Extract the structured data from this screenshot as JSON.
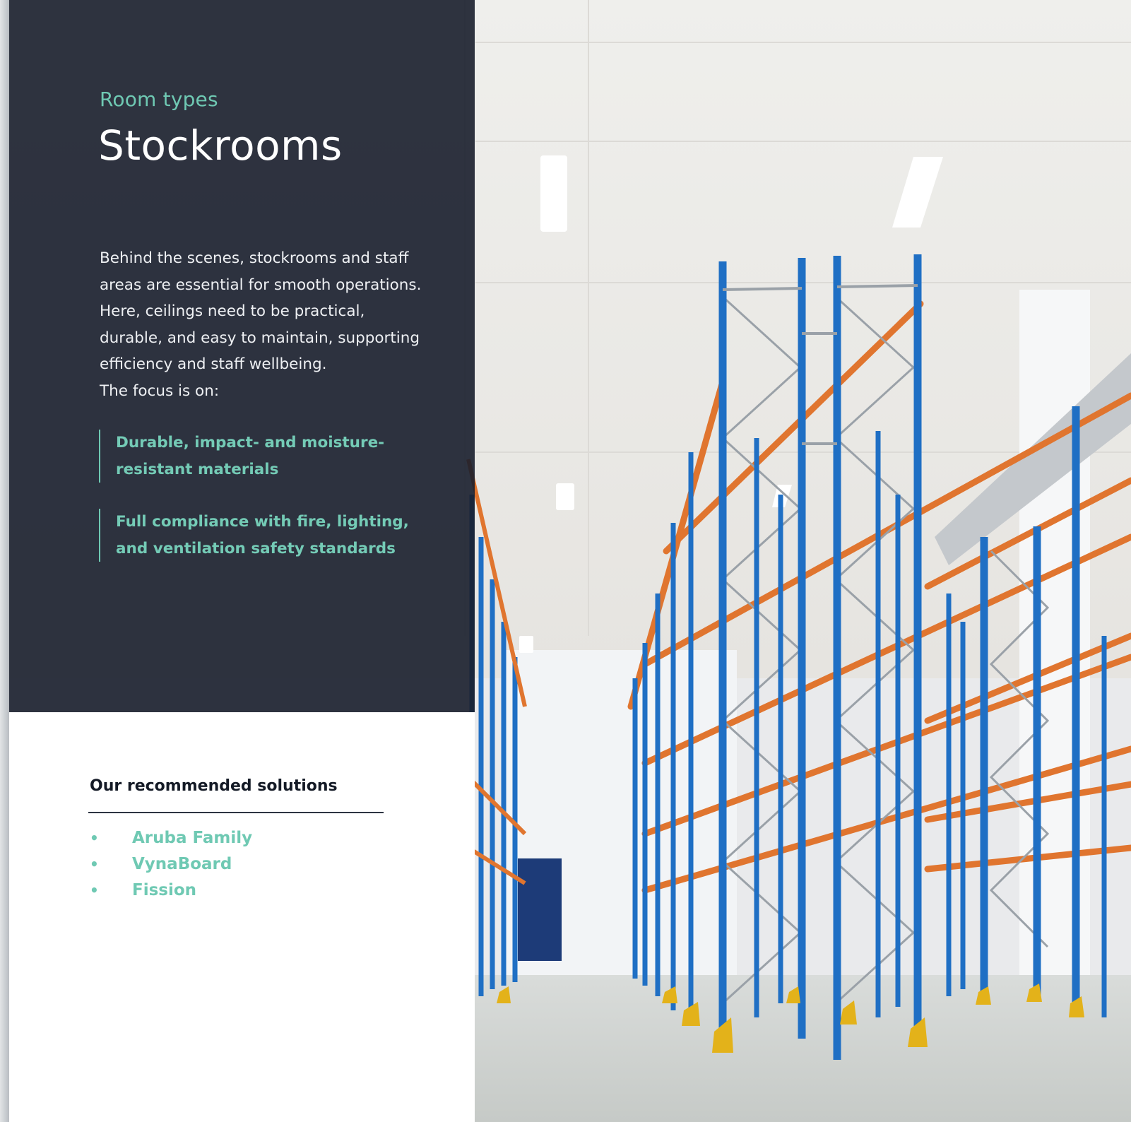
{
  "header": {
    "eyebrow": "Room types",
    "title": "Stockrooms"
  },
  "intro": {
    "lines": [
      "Behind the scenes, stockrooms and staff",
      "areas are essential for smooth operations.",
      "Here, ceilings need to be practical,",
      "durable, and easy to maintain, supporting",
      "efficiency and staff wellbeing.",
      "The focus is on:"
    ]
  },
  "focus": [
    {
      "lines": [
        "Durable, impact- and moisture-",
        "resistant materials"
      ]
    },
    {
      "lines": [
        "Full compliance with fire, lighting,",
        "and ventilation safety standards"
      ]
    }
  ],
  "solutions": {
    "heading": "Our recommended solutions",
    "bullet": "•",
    "items": [
      "Aruba Family",
      "VynaBoard",
      "Fission"
    ]
  },
  "colors": {
    "accent": "#6fc9b3",
    "panel_dark": "#181e2c",
    "rack_blue": "#1f6fc4",
    "rack_orange": "#e0752f",
    "rack_foot": "#e3b21a"
  }
}
